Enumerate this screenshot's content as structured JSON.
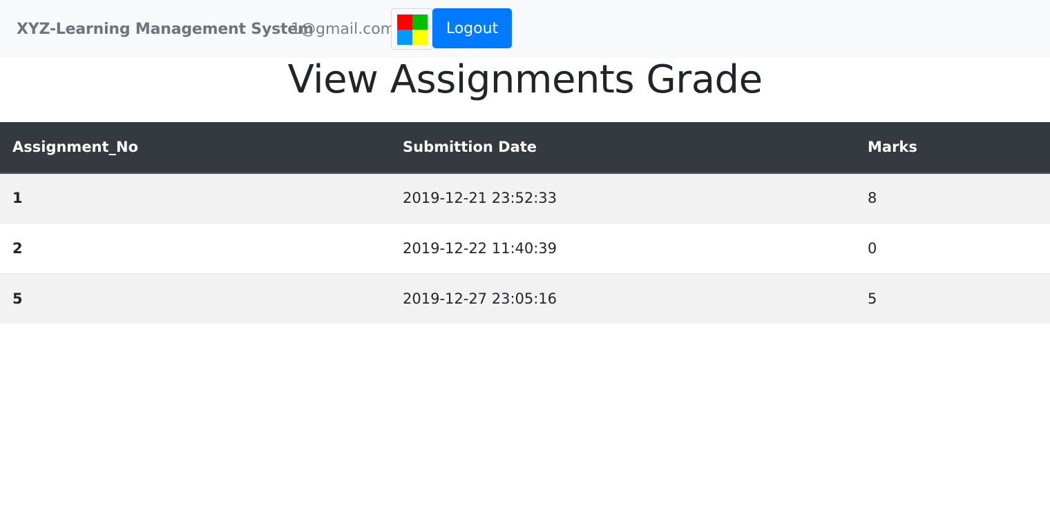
{
  "navbar": {
    "brand": "XYZ-Learning Management System",
    "user_email": "1@gmail.com",
    "avatar_icon": "windows-logo-icon",
    "logo_colors": [
      "#ff0000",
      "#00c000",
      "#0099ff",
      "#ffff00"
    ],
    "logout_label": "Logout",
    "logout_color": "#007bff"
  },
  "page": {
    "title": "View Assignments Grade"
  },
  "table": {
    "headers": [
      "Assignment_No",
      "Submittion Date",
      "Marks"
    ],
    "header_bg": "#343a40",
    "rows": [
      {
        "assignment_no": "1",
        "submission_date": "2019-12-21 23:52:33",
        "marks": "8"
      },
      {
        "assignment_no": "2",
        "submission_date": "2019-12-22 11:40:39",
        "marks": "0"
      },
      {
        "assignment_no": "5",
        "submission_date": "2019-12-27 23:05:16",
        "marks": "5"
      }
    ]
  }
}
